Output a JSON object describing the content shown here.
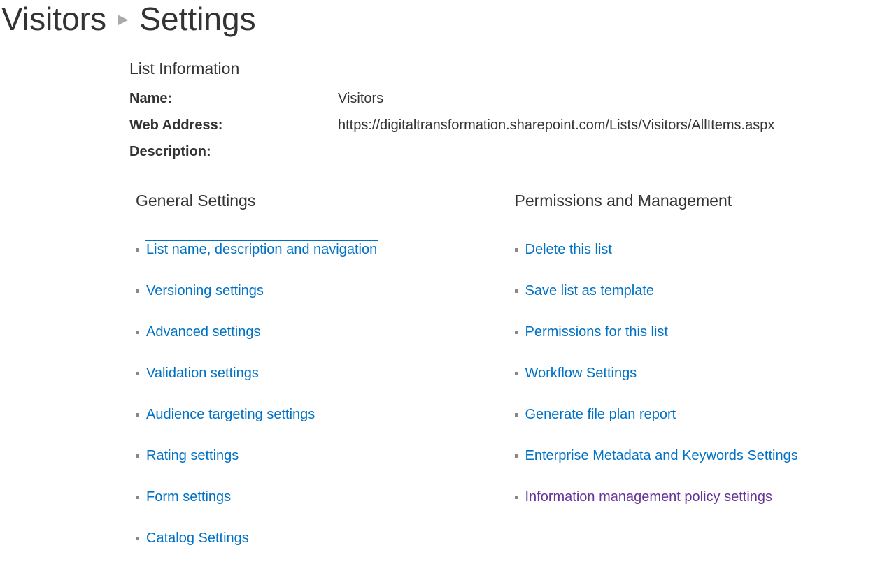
{
  "header": {
    "breadcrumb_parent": "Visitors",
    "breadcrumb_current": "Settings"
  },
  "list_info": {
    "heading": "List Information",
    "name_label": "Name:",
    "name_value": "Visitors",
    "web_address_label": "Web Address:",
    "web_address_value": "https://digitaltransformation.sharepoint.com/Lists/Visitors/AllItems.aspx",
    "description_label": "Description:",
    "description_value": ""
  },
  "sections": {
    "general": {
      "heading": "General Settings",
      "links": [
        "List name, description and navigation",
        "Versioning settings",
        "Advanced settings",
        "Validation settings",
        "Audience targeting settings",
        "Rating settings",
        "Form settings",
        "Catalog Settings"
      ]
    },
    "permissions": {
      "heading": "Permissions and Management",
      "links": [
        "Delete this list",
        "Save list as template",
        "Permissions for this list",
        "Workflow Settings",
        "Generate file plan report",
        "Enterprise Metadata and Keywords Settings",
        "Information management policy settings"
      ]
    }
  }
}
